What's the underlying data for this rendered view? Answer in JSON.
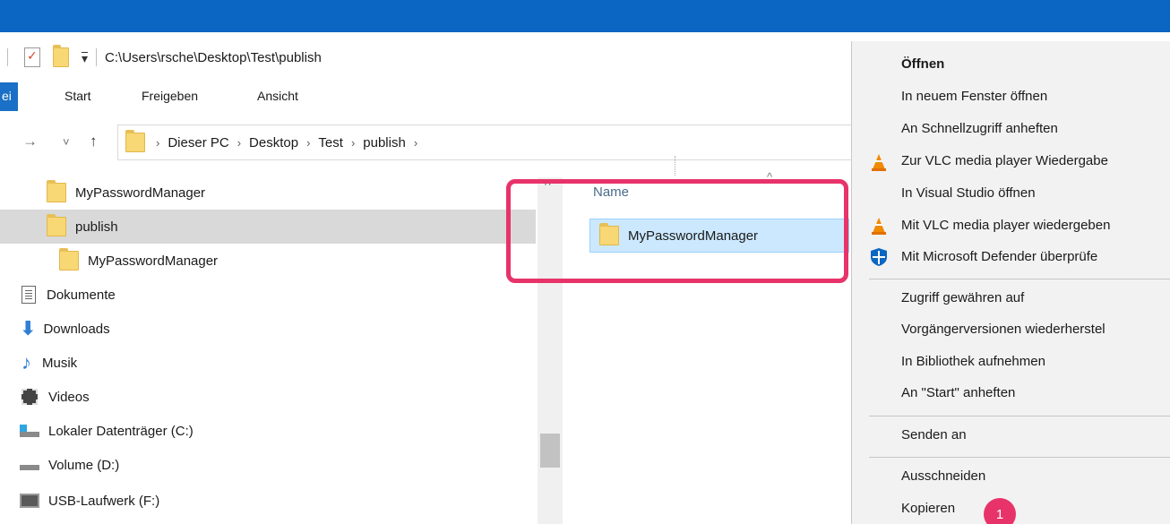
{
  "window": {
    "path": "C:\\Users\\rsche\\Desktop\\Test\\publish"
  },
  "qat": {
    "dropdown_glyph": "▾"
  },
  "ribbon": {
    "tabs": [
      "ei",
      "Start",
      "Freigeben",
      "Ansicht"
    ]
  },
  "nav_buttons": {
    "forward": "→",
    "recent": "˅",
    "up": "↑"
  },
  "breadcrumb": [
    "Dieser PC",
    "Desktop",
    "Test",
    "publish"
  ],
  "breadcrumb_sep": "›",
  "navigation_pane": {
    "items": [
      {
        "label": "MyPasswordManager",
        "icon": "folder-icon"
      },
      {
        "label": "publish",
        "icon": "folder-icon",
        "selected": true
      },
      {
        "label": "MyPasswordManager",
        "icon": "folder-icon"
      },
      {
        "label": "Dokumente",
        "icon": "documents-icon"
      },
      {
        "label": "Downloads",
        "icon": "download-arrow-icon"
      },
      {
        "label": "Musik",
        "icon": "music-note-icon"
      },
      {
        "label": "Videos",
        "icon": "film-icon"
      },
      {
        "label": "Lokaler Datenträger (C:)",
        "icon": "windows-drive-icon"
      },
      {
        "label": "Volume (D:)",
        "icon": "drive-icon"
      },
      {
        "label": "USB-Laufwerk (F:)",
        "icon": "usb-drive-icon"
      }
    ]
  },
  "content": {
    "column_header": "Name",
    "sort_indicator": "^",
    "items": [
      {
        "label": "MyPasswordManager",
        "icon": "folder-icon",
        "selected": true
      }
    ]
  },
  "context_menu": {
    "items": [
      {
        "label": "Öffnen",
        "bold": true
      },
      {
        "label": "In neuem Fenster öffnen"
      },
      {
        "label": "An Schnellzugriff anheften"
      },
      {
        "label": "Zur VLC media player Wiedergabe",
        "icon": "vlc-cone-icon"
      },
      {
        "label": "In Visual Studio öffnen"
      },
      {
        "label": "Mit VLC media player wiedergeben",
        "icon": "vlc-cone-icon"
      },
      {
        "label": "Mit Microsoft Defender überprüfe",
        "icon": "defender-shield-icon"
      },
      {
        "label": "Zugriff gewähren auf"
      },
      {
        "label": "Vorgängerversionen wiederherstel"
      },
      {
        "label": "In Bibliothek aufnehmen"
      },
      {
        "label": "An \"Start\" anheften"
      },
      {
        "label": "Senden an"
      },
      {
        "label": "Ausschneiden"
      },
      {
        "label": "Kopieren"
      }
    ]
  },
  "annotation": {
    "badge": "1",
    "highlight_color": "#e8336a"
  },
  "colors": {
    "titlebar": "#0a66c2",
    "selection": "#cce8ff",
    "folder": "#f8d775"
  }
}
